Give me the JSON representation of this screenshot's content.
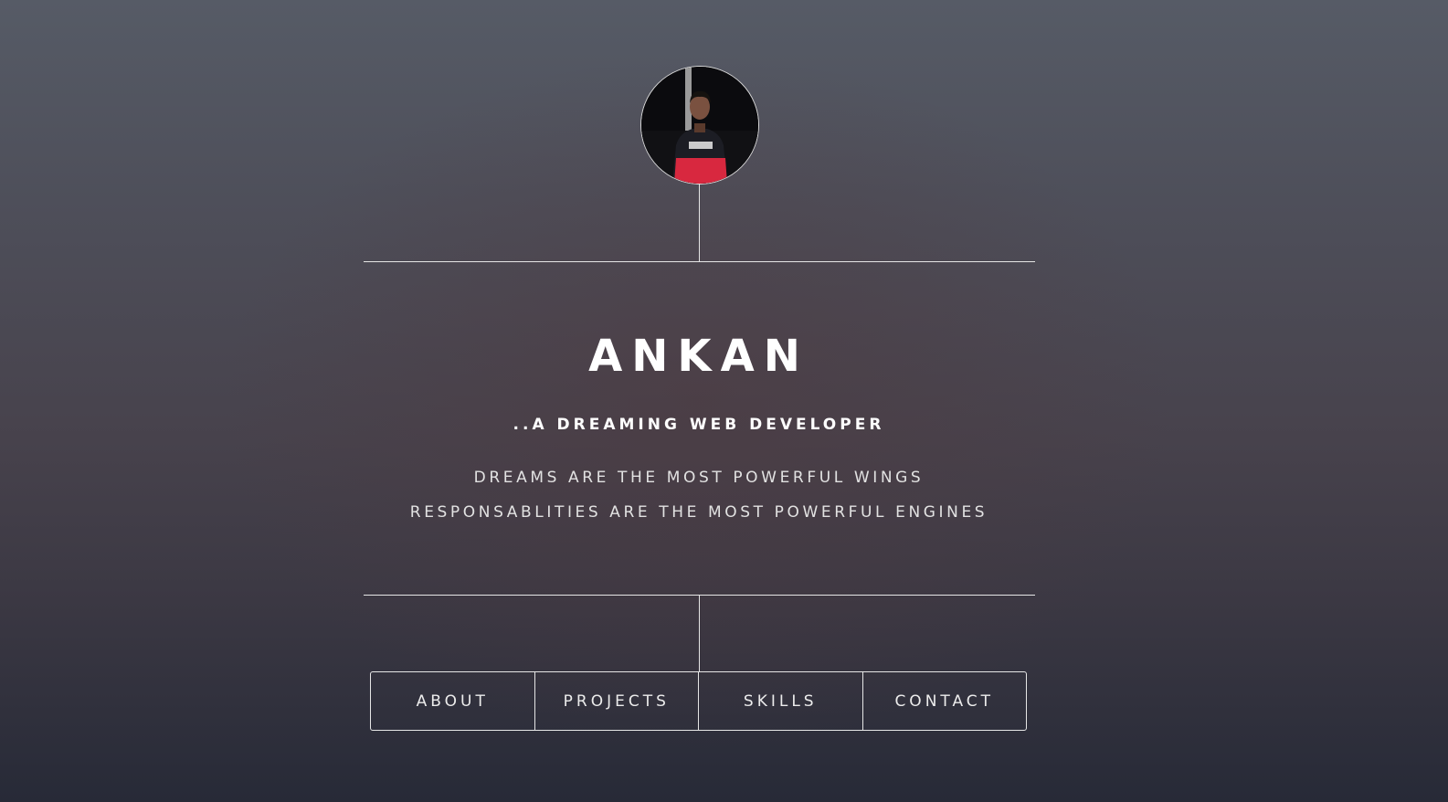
{
  "profile": {
    "avatar_alt": "Ankan profile photo",
    "name": "ANKAN",
    "tagline": "..A DREAMING WEB DEVELOPER",
    "quote_line_1": "DREAMS ARE THE MOST POWERFUL WINGS",
    "quote_line_2": "RESPONSABLITIES ARE THE MOST POWERFUL ENGINES"
  },
  "nav": {
    "items": [
      {
        "label": "ABOUT"
      },
      {
        "label": "PROJECTS"
      },
      {
        "label": "SKILLS"
      },
      {
        "label": "CONTACT"
      }
    ]
  },
  "colors": {
    "line": "#e6e6e6",
    "text": "#ffffff",
    "hoodie_accent": "#d8283f"
  }
}
